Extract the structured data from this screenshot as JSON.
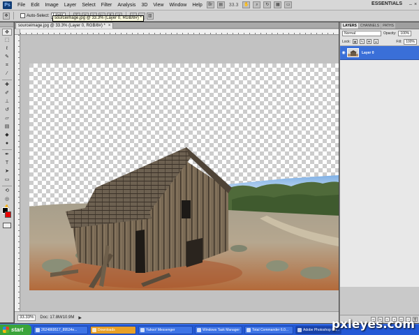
{
  "app": {
    "logo_text": "Ps",
    "workspace": "ESSENTIALS",
    "zoom_menu": "33.3"
  },
  "menu": [
    "File",
    "Edit",
    "Image",
    "Layer",
    "Select",
    "Filter",
    "Analysis",
    "3D",
    "View",
    "Window",
    "Help"
  ],
  "options_bar": {
    "auto_select_label": "Auto-Select:",
    "auto_select_target": "Layer",
    "tooltip": "sourceimage.jpg @ 33.3% (Layer 0, RGB/8#) *"
  },
  "document": {
    "tab_title": "sourceimage.jpg @ 33.3% (Layer 0, RGB/8#) *",
    "tab_close": "×",
    "status_zoom": "33.33%",
    "status_doc": "Doc: 17.8M/10.9M"
  },
  "colors": {
    "foreground": "#000000",
    "background": "#e80000",
    "layer_selected": "#3a6fd8"
  },
  "layers_panel": {
    "tabs": [
      "LAYERS",
      "CHANNELS",
      "PATHS"
    ],
    "blend_mode": "Normal",
    "opacity_label": "Opacity:",
    "opacity_value": "100%",
    "lock_label": "Lock:",
    "fill_label": "Fill:",
    "fill_value": "100%",
    "layers": [
      {
        "name": "Layer 0",
        "visible": true,
        "selected": true
      }
    ]
  },
  "taskbar": {
    "start_label": "start",
    "tasks": [
      "2624869517_89534e...",
      "Downloads",
      "Yahoo! Messenger",
      "Windows Task Manager",
      "Total Commander 6.0...",
      "Adobe Photoshop CS..."
    ]
  },
  "watermark": "pxleyes.com"
}
